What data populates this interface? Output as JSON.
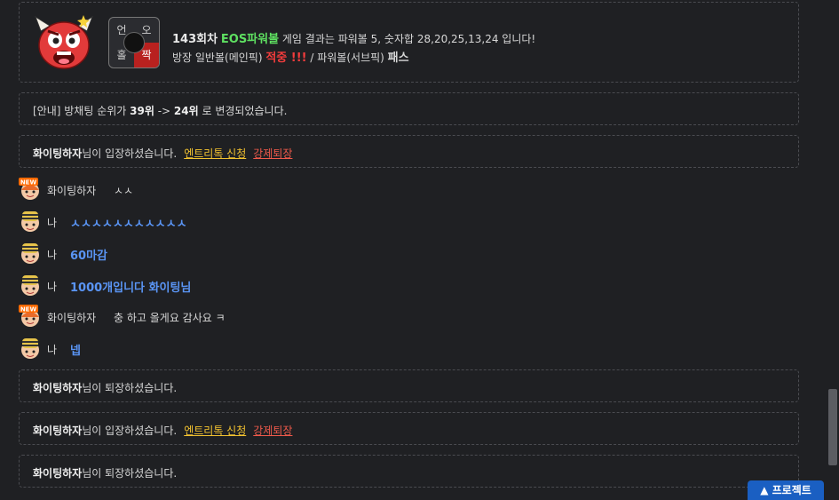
{
  "result": {
    "round": "143회차",
    "game_name": "EOS파워볼",
    "text_mid": " 게임 결과는 파워볼 5, 숫자합 28,20,25,13,24 입니다!",
    "line2_prefix": "방장 일반볼(메인픽) ",
    "hit": "적중 !!!",
    "line2_mid": " / 파워볼(서브픽) ",
    "pass": "패스",
    "grid": {
      "tl": "언",
      "tr": "오",
      "bl": "홀",
      "br": "짝"
    }
  },
  "notice": {
    "prefix": "[안내] 방채팅 순위가 ",
    "from_rank": "39위",
    "arrow": " -> ",
    "to_rank": "24위",
    "suffix": " 로 변경되었습니다."
  },
  "messages": [
    {
      "type": "system",
      "user": "화이팅하자",
      "text": "님이 입장하셨습니다.",
      "link1": "엔트리톡 신청",
      "link2": "강제퇴장"
    },
    {
      "type": "chat",
      "avatar": "new",
      "nick": "화이팅하자",
      "text": "ㅅㅅ"
    },
    {
      "type": "chat",
      "avatar": "me",
      "nick": "나",
      "text": "ㅅㅅㅅㅅㅅㅅㅅㅅㅅㅅㅅ"
    },
    {
      "type": "chat",
      "avatar": "me",
      "nick": "나",
      "text": "60마감"
    },
    {
      "type": "chat",
      "avatar": "me",
      "nick": "나",
      "text": "1000개입니다 화이팅님"
    },
    {
      "type": "chat",
      "avatar": "new",
      "nick": "화이팅하자",
      "text": "충 하고 올게요 감사요 ㅋ"
    },
    {
      "type": "chat",
      "avatar": "me",
      "nick": "나",
      "text": "넵"
    },
    {
      "type": "system",
      "user": "화이팅하자",
      "text": "님이 퇴장하셨습니다."
    },
    {
      "type": "system",
      "user": "화이팅하자",
      "text": "님이 입장하셨습니다.",
      "link1": "엔트리톡 신청",
      "link2": "강제퇴장"
    },
    {
      "type": "system",
      "user": "화이팅하자",
      "text": "님이 퇴장하셨습니다."
    }
  ],
  "new_badge": "NEW",
  "project_button": "▲ 프로젝트",
  "colors": {
    "background": "#1f2023",
    "accent_green": "#5ee061",
    "accent_red": "#f23c3c",
    "my_message": "#5a95f5",
    "link_yellow": "#f2c230",
    "link_red": "#f05a4b",
    "project_blue": "#1a5fc2"
  }
}
